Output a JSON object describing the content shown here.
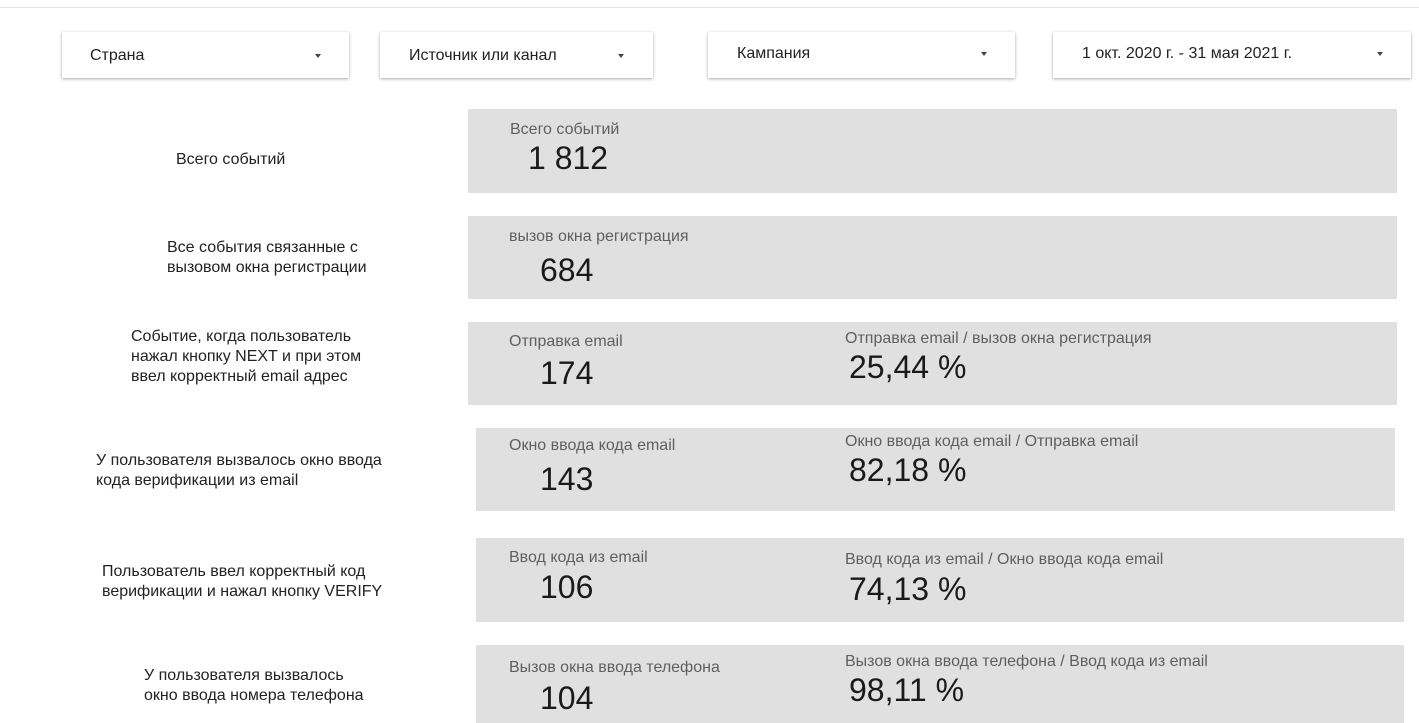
{
  "filters": {
    "country": "Страна",
    "source": "Источник или канал",
    "campaign": "Кампания",
    "date_range": "1 окт. 2020 г. - 31 мая 2021 г."
  },
  "rows": [
    {
      "description": [
        "Всего событий"
      ],
      "metric_label": "Всего событий",
      "metric_value": "1 812",
      "ratio_label": "",
      "ratio_value": ""
    },
    {
      "description": [
        "Все события связанные с",
        "вызовом окна регистрации"
      ],
      "metric_label": "вызов окна регистрация",
      "metric_value": "684",
      "ratio_label": "",
      "ratio_value": ""
    },
    {
      "description": [
        "Событие, когда пользователь",
        "нажал кнопку NEXT и при этом",
        "ввел корректный email адрес"
      ],
      "metric_label": "Отправка email",
      "metric_value": "174",
      "ratio_label": "Отправка email / вызов окна регистрация",
      "ratio_value": "25,44 %"
    },
    {
      "description": [
        "У пользователя вызвалось окно ввода",
        "кода верификации из email"
      ],
      "metric_label": "Окно ввода кода email",
      "metric_value": "143",
      "ratio_label": "Окно ввода кода email / Отправка email",
      "ratio_value": "82,18 %"
    },
    {
      "description": [
        "Пользователь ввел корректный код",
        "верификации и нажал кнопку VERIFY"
      ],
      "metric_label": "Ввод кода из email",
      "metric_value": "106",
      "ratio_label": "Ввод кода из email / Окно ввода кода email",
      "ratio_value": "74,13 %"
    },
    {
      "description": [
        "У пользователя вызвалось",
        "окно ввода номера телефона"
      ],
      "metric_label": "Вызов окна ввода телефона",
      "metric_value": "104",
      "ratio_label": "Вызов окна ввода телефона / Ввод кода из email",
      "ratio_value": "98,11 %"
    }
  ]
}
